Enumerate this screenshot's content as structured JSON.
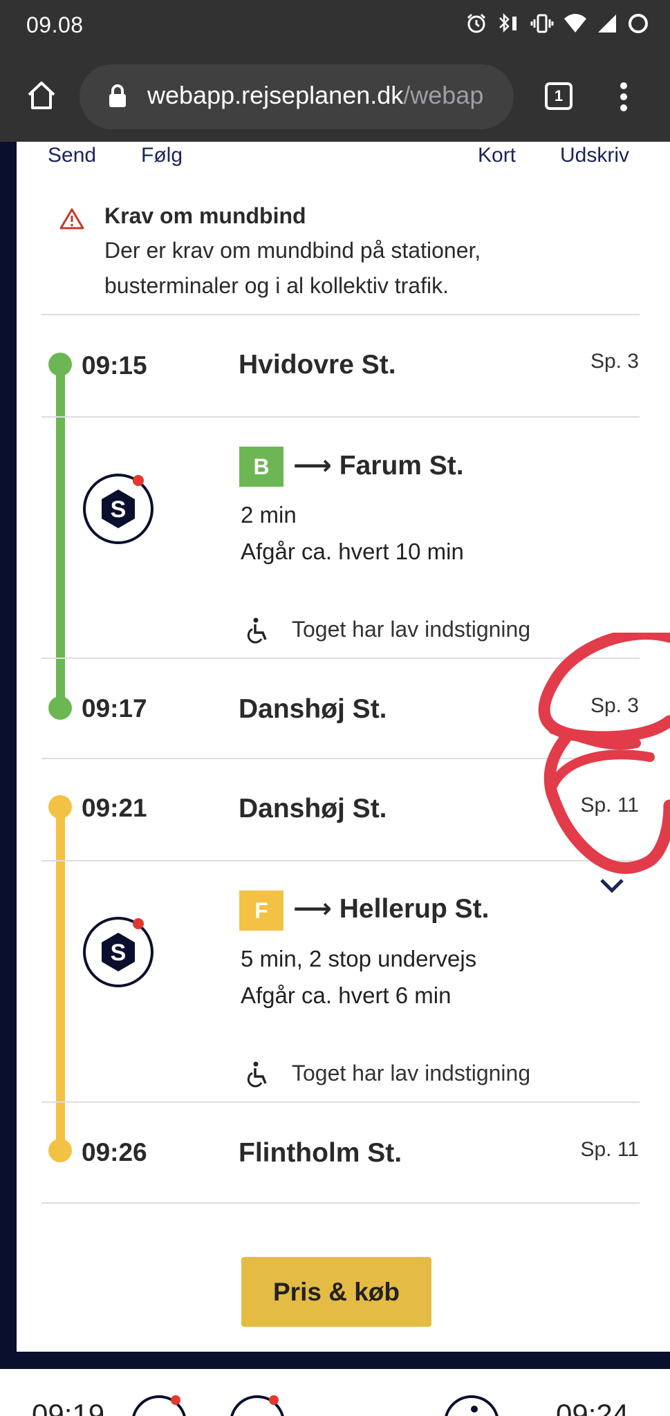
{
  "status_bar": {
    "time": "09.08"
  },
  "browser": {
    "url_host": "webapp.rejseplanen.dk",
    "url_path": "/webap",
    "tab_count": "1"
  },
  "actions": {
    "send": "Send",
    "follow": "Følg",
    "map": "Kort",
    "print": "Udskriv"
  },
  "notice": {
    "title": "Krav om mundbind",
    "line1": "Der er krav om mundbind på stationer,",
    "line2": "busterminaler og i al kollektiv trafik."
  },
  "legs": [
    {
      "dep_time": "09:15",
      "dep_station": "Hvidovre St.",
      "dep_platform": "Sp. 3",
      "line": "B",
      "line_color": "#6cb753",
      "destination": "Farum St.",
      "duration": "2 min",
      "frequency": "Afgår ca. hvert 10 min",
      "accessibility": "Toget har lav indstigning",
      "arr_time": "09:17",
      "arr_station": "Danshøj St.",
      "arr_platform": "Sp. 3"
    },
    {
      "dep_time": "09:21",
      "dep_station": "Danshøj St.",
      "dep_platform": "Sp. 11",
      "line": "F",
      "line_color": "#f3c244",
      "destination": "Hellerup St.",
      "duration": "5 min, 2 stop undervejs",
      "frequency": "Afgår ca. hvert 6 min",
      "accessibility": "Toget har lav indstigning",
      "arr_time": "09:26",
      "arr_station": "Flintholm St.",
      "arr_platform": "Sp. 11"
    }
  ],
  "buy_button": "Pris & køb",
  "bottom": {
    "left_time": "09:19",
    "right_time": "09:24"
  },
  "colors": {
    "annotation": "#e23b4a",
    "accent_navy": "#0b0f2e",
    "buy": "#e4bb45"
  }
}
